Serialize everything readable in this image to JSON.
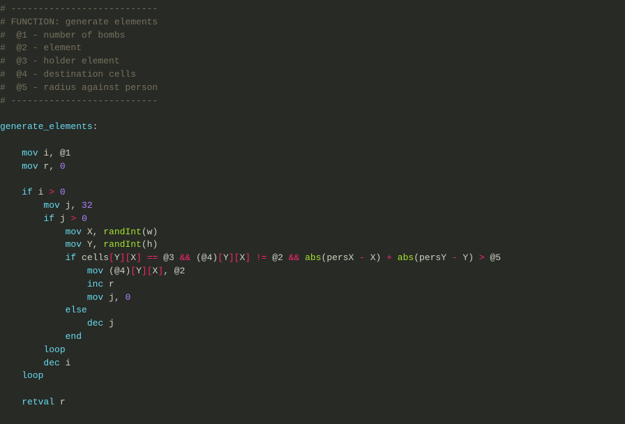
{
  "code": {
    "tokens": [
      [
        {
          "cls": "comment",
          "t": "# ---------------------------"
        }
      ],
      [
        {
          "cls": "comment",
          "t": "# FUNCTION: generate elements"
        }
      ],
      [
        {
          "cls": "comment",
          "t": "#  @1 - number of bombs"
        }
      ],
      [
        {
          "cls": "comment",
          "t": "#  @2 - element"
        }
      ],
      [
        {
          "cls": "comment",
          "t": "#  @3 - holder element"
        }
      ],
      [
        {
          "cls": "comment",
          "t": "#  @4 - destination cells"
        }
      ],
      [
        {
          "cls": "comment",
          "t": "#  @5 - radius against person"
        }
      ],
      [
        {
          "cls": "comment",
          "t": "# ---------------------------"
        }
      ],
      [
        {
          "cls": "default",
          "t": ""
        }
      ],
      [
        {
          "cls": "label",
          "t": "generate_elements"
        },
        {
          "cls": "default",
          "t": ":"
        }
      ],
      [
        {
          "cls": "default",
          "t": ""
        }
      ],
      [
        {
          "cls": "default",
          "t": "    "
        },
        {
          "cls": "keyword",
          "t": "mov"
        },
        {
          "cls": "default",
          "t": " i, @1"
        }
      ],
      [
        {
          "cls": "default",
          "t": "    "
        },
        {
          "cls": "keyword",
          "t": "mov"
        },
        {
          "cls": "default",
          "t": " r, "
        },
        {
          "cls": "num",
          "t": "0"
        }
      ],
      [
        {
          "cls": "default",
          "t": ""
        }
      ],
      [
        {
          "cls": "default",
          "t": "    "
        },
        {
          "cls": "keyword",
          "t": "if"
        },
        {
          "cls": "default",
          "t": " i "
        },
        {
          "cls": "op",
          "t": ">"
        },
        {
          "cls": "default",
          "t": " "
        },
        {
          "cls": "num",
          "t": "0"
        }
      ],
      [
        {
          "cls": "default",
          "t": "        "
        },
        {
          "cls": "keyword",
          "t": "mov"
        },
        {
          "cls": "default",
          "t": " j, "
        },
        {
          "cls": "num",
          "t": "32"
        }
      ],
      [
        {
          "cls": "default",
          "t": "        "
        },
        {
          "cls": "keyword",
          "t": "if"
        },
        {
          "cls": "default",
          "t": " j "
        },
        {
          "cls": "op",
          "t": ">"
        },
        {
          "cls": "default",
          "t": " "
        },
        {
          "cls": "num",
          "t": "0"
        }
      ],
      [
        {
          "cls": "default",
          "t": "            "
        },
        {
          "cls": "keyword",
          "t": "mov"
        },
        {
          "cls": "default",
          "t": " X, "
        },
        {
          "cls": "func",
          "t": "randInt"
        },
        {
          "cls": "default",
          "t": "(w)"
        }
      ],
      [
        {
          "cls": "default",
          "t": "            "
        },
        {
          "cls": "keyword",
          "t": "mov"
        },
        {
          "cls": "default",
          "t": " Y, "
        },
        {
          "cls": "func",
          "t": "randInt"
        },
        {
          "cls": "default",
          "t": "(h)"
        }
      ],
      [
        {
          "cls": "default",
          "t": "            "
        },
        {
          "cls": "keyword",
          "t": "if"
        },
        {
          "cls": "default",
          "t": " cells"
        },
        {
          "cls": "bracket",
          "t": "["
        },
        {
          "cls": "default",
          "t": "Y"
        },
        {
          "cls": "bracket",
          "t": "]"
        },
        {
          "cls": "bracket",
          "t": "["
        },
        {
          "cls": "default",
          "t": "X"
        },
        {
          "cls": "bracket",
          "t": "]"
        },
        {
          "cls": "default",
          "t": " "
        },
        {
          "cls": "op",
          "t": "=="
        },
        {
          "cls": "default",
          "t": " @3 "
        },
        {
          "cls": "op",
          "t": "&&"
        },
        {
          "cls": "default",
          "t": " (@4)"
        },
        {
          "cls": "bracket",
          "t": "["
        },
        {
          "cls": "default",
          "t": "Y"
        },
        {
          "cls": "bracket",
          "t": "]"
        },
        {
          "cls": "bracket",
          "t": "["
        },
        {
          "cls": "default",
          "t": "X"
        },
        {
          "cls": "bracket",
          "t": "]"
        },
        {
          "cls": "default",
          "t": " "
        },
        {
          "cls": "op",
          "t": "!="
        },
        {
          "cls": "default",
          "t": " @2 "
        },
        {
          "cls": "op",
          "t": "&&"
        },
        {
          "cls": "default",
          "t": " "
        },
        {
          "cls": "func",
          "t": "abs"
        },
        {
          "cls": "default",
          "t": "(persX "
        },
        {
          "cls": "op",
          "t": "-"
        },
        {
          "cls": "default",
          "t": " X) "
        },
        {
          "cls": "op",
          "t": "+"
        },
        {
          "cls": "default",
          "t": " "
        },
        {
          "cls": "func",
          "t": "abs"
        },
        {
          "cls": "default",
          "t": "(persY "
        },
        {
          "cls": "op",
          "t": "-"
        },
        {
          "cls": "default",
          "t": " Y) "
        },
        {
          "cls": "op",
          "t": ">"
        },
        {
          "cls": "default",
          "t": " @5"
        }
      ],
      [
        {
          "cls": "default",
          "t": "                "
        },
        {
          "cls": "keyword",
          "t": "mov"
        },
        {
          "cls": "default",
          "t": " (@4)"
        },
        {
          "cls": "bracket",
          "t": "["
        },
        {
          "cls": "default",
          "t": "Y"
        },
        {
          "cls": "bracket",
          "t": "]"
        },
        {
          "cls": "bracket",
          "t": "["
        },
        {
          "cls": "default",
          "t": "X"
        },
        {
          "cls": "bracket",
          "t": "]"
        },
        {
          "cls": "default",
          "t": ", @2"
        }
      ],
      [
        {
          "cls": "default",
          "t": "                "
        },
        {
          "cls": "keyword",
          "t": "inc"
        },
        {
          "cls": "default",
          "t": " r"
        }
      ],
      [
        {
          "cls": "default",
          "t": "                "
        },
        {
          "cls": "keyword",
          "t": "mov"
        },
        {
          "cls": "default",
          "t": " j, "
        },
        {
          "cls": "num",
          "t": "0"
        }
      ],
      [
        {
          "cls": "default",
          "t": "            "
        },
        {
          "cls": "keyword",
          "t": "else"
        }
      ],
      [
        {
          "cls": "default",
          "t": "                "
        },
        {
          "cls": "keyword",
          "t": "dec"
        },
        {
          "cls": "default",
          "t": " j"
        }
      ],
      [
        {
          "cls": "default",
          "t": "            "
        },
        {
          "cls": "keyword",
          "t": "end"
        }
      ],
      [
        {
          "cls": "default",
          "t": "        "
        },
        {
          "cls": "keyword",
          "t": "loop"
        }
      ],
      [
        {
          "cls": "default",
          "t": "        "
        },
        {
          "cls": "keyword",
          "t": "dec"
        },
        {
          "cls": "default",
          "t": " i"
        }
      ],
      [
        {
          "cls": "default",
          "t": "    "
        },
        {
          "cls": "keyword",
          "t": "loop"
        }
      ],
      [
        {
          "cls": "default",
          "t": ""
        }
      ],
      [
        {
          "cls": "default",
          "t": "    "
        },
        {
          "cls": "keyword",
          "t": "retval"
        },
        {
          "cls": "default",
          "t": " r"
        }
      ]
    ]
  }
}
